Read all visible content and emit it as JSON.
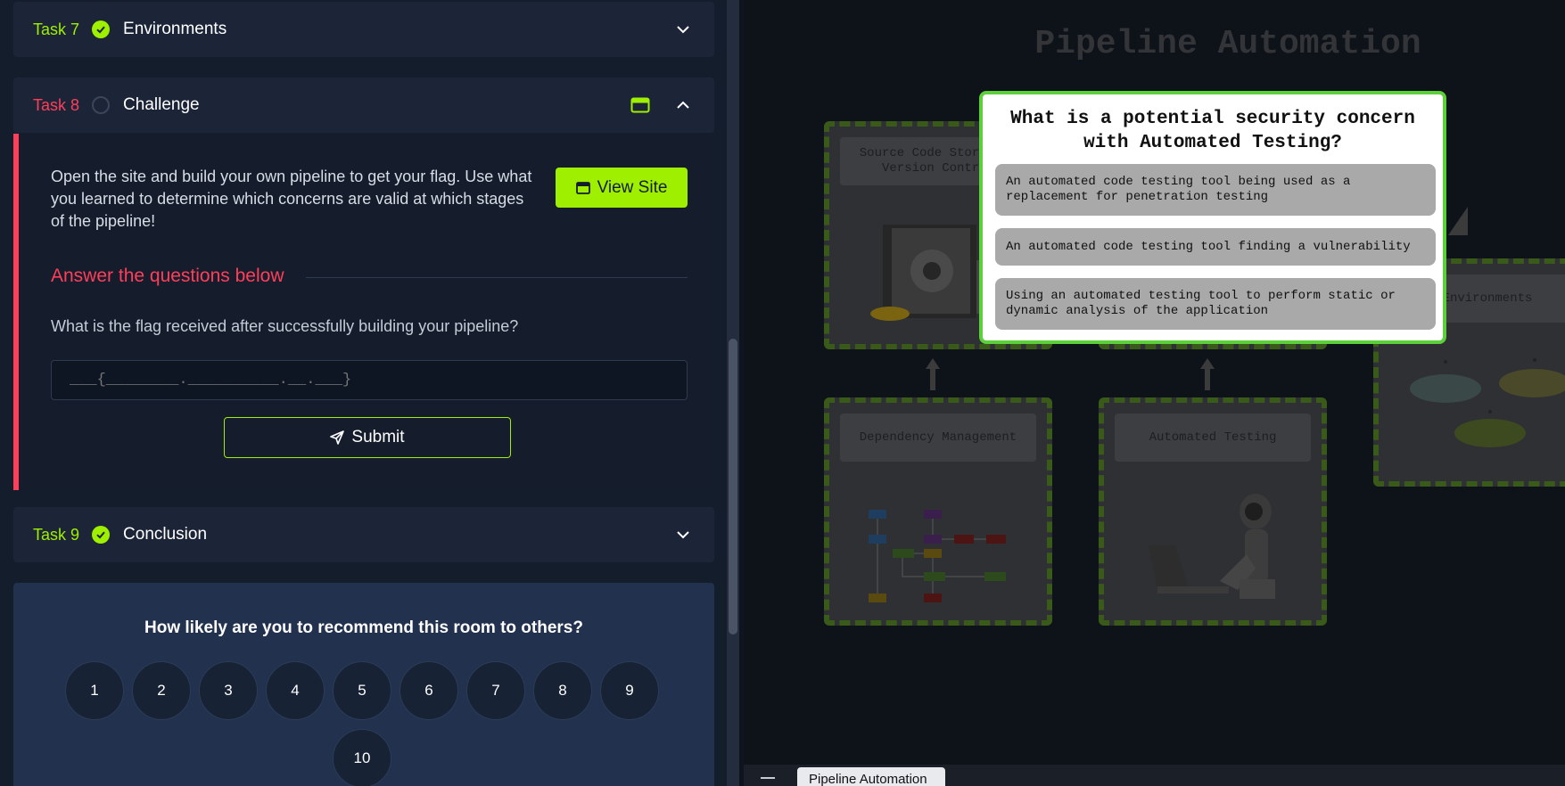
{
  "tasks": {
    "t7": {
      "num": "Task 7",
      "title": "Environments"
    },
    "t8": {
      "num": "Task 8",
      "title": "Challenge"
    },
    "t9": {
      "num": "Task 9",
      "title": "Conclusion"
    }
  },
  "challenge": {
    "description": "Open the site and build your own pipeline to get your flag. Use what you learned to determine which concerns are valid at which stages of the pipeline!",
    "view_site_label": "View Site",
    "answer_heading": "Answer the questions below",
    "question": "What is the flag received after successfully building your pipeline?",
    "flag_placeholder": "___{________.__________.__.___}",
    "submit_label": "Submit"
  },
  "rating": {
    "question": "How likely are you to recommend this room to others?",
    "options": [
      "1",
      "2",
      "3",
      "4",
      "5",
      "6",
      "7",
      "8",
      "9",
      "10"
    ]
  },
  "site": {
    "title": "Pipeline Automation",
    "stages": {
      "source": "Source Code Storage &\nVersion Control",
      "deps": "Dependency Management",
      "testing": "Automated Testing",
      "envs": "Environments"
    },
    "modal": {
      "question": "What is a potential security concern with Automated Testing?",
      "options": [
        "An automated code testing tool being used as a replacement for penetration testing",
        "An automated code testing tool finding a vulnerability",
        "Using an automated testing tool to perform static or dynamic analysis of the application"
      ]
    }
  },
  "window_tab": "Pipeline Automation",
  "colors": {
    "accent_green": "#9fef00",
    "accent_red": "#ff3e5a",
    "card_bg": "#1c2538",
    "modal_border": "#5bd03a"
  },
  "icons": [
    "check-circle-icon",
    "chevron-down-icon",
    "chevron-up-icon",
    "browser-window-icon",
    "paper-plane-icon",
    "menu-icon"
  ]
}
